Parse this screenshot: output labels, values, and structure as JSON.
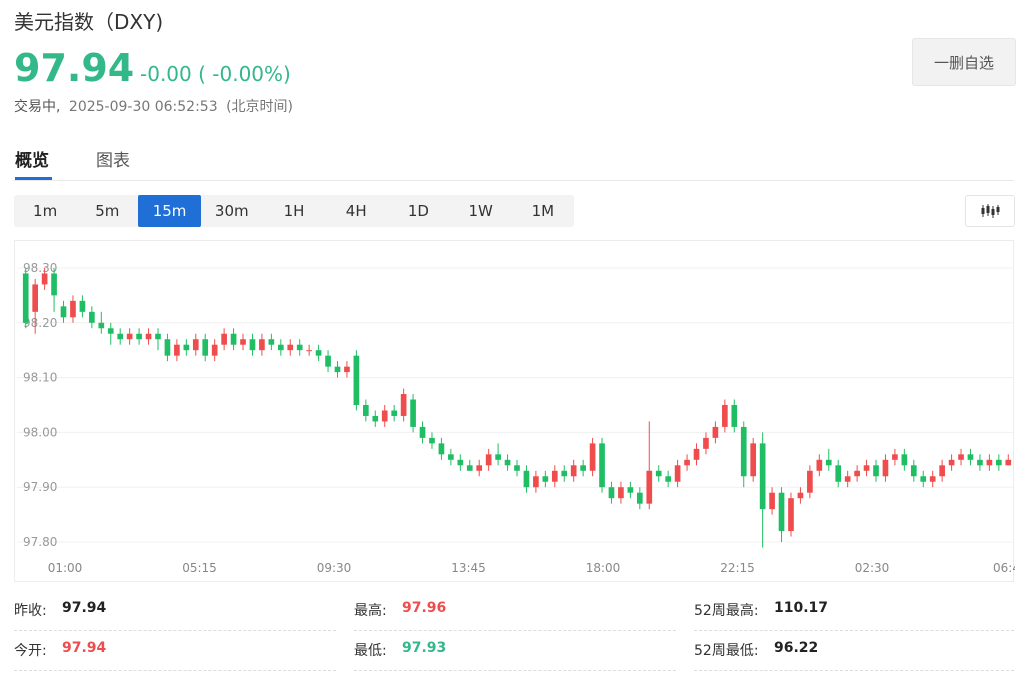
{
  "header": {
    "title": "美元指数（DXY)",
    "price": "97.94",
    "change": "-0.00 ( -0.00%)",
    "status": "交易中,",
    "datetime": "2025-09-30 06:52:53",
    "timezone": "(北京时间)",
    "remove_watchlist_label": "一删自选"
  },
  "tabs": [
    {
      "label": "概览",
      "active": true
    },
    {
      "label": "图表",
      "active": false
    }
  ],
  "periods": [
    {
      "label": "1m"
    },
    {
      "label": "5m"
    },
    {
      "label": "15m",
      "active": true
    },
    {
      "label": "30m"
    },
    {
      "label": "1H"
    },
    {
      "label": "4H"
    },
    {
      "label": "1D"
    },
    {
      "label": "1W"
    },
    {
      "label": "1M"
    }
  ],
  "chart_type_icon": "candlestick-icon",
  "stats": {
    "prev_close_label": "昨收:",
    "prev_close": "97.94",
    "high_label": "最高:",
    "high": "97.96",
    "week52_high_label": "52周最高:",
    "week52_high": "110.17",
    "open_label": "今开:",
    "open": "97.94",
    "low_label": "最低:",
    "low": "97.93",
    "week52_low_label": "52周最低:",
    "week52_low": "96.22"
  },
  "colors": {
    "up": "#ef4d4d",
    "down": "#1fbe64",
    "accent": "#1f6fd6",
    "price": "#33b88a"
  },
  "chart_data": {
    "type": "candlestick",
    "interval": "15m",
    "ylim": [
      97.78,
      98.32
    ],
    "yticks": [
      "98.30",
      "98.20",
      "98.10",
      "98.00",
      "97.90",
      "97.80"
    ],
    "xticks": [
      "01:00",
      "05:15",
      "09:30",
      "13:45",
      "18:00",
      "22:15",
      "02:30",
      "06:4"
    ],
    "grid": true,
    "candles": [
      [
        98.29,
        98.2,
        98.3,
        98.19
      ],
      [
        98.22,
        98.27,
        98.28,
        98.18
      ],
      [
        98.27,
        98.29,
        98.3,
        98.26
      ],
      [
        98.29,
        98.25,
        98.3,
        98.22
      ],
      [
        98.23,
        98.21,
        98.24,
        98.2
      ],
      [
        98.21,
        98.24,
        98.25,
        98.2
      ],
      [
        98.24,
        98.22,
        98.25,
        98.21
      ],
      [
        98.22,
        98.2,
        98.23,
        98.19
      ],
      [
        98.2,
        98.19,
        98.22,
        98.18
      ],
      [
        98.19,
        98.18,
        98.2,
        98.16
      ],
      [
        98.18,
        98.17,
        98.19,
        98.16
      ],
      [
        98.17,
        98.18,
        98.19,
        98.16
      ],
      [
        98.18,
        98.17,
        98.19,
        98.16
      ],
      [
        98.17,
        98.18,
        98.19,
        98.16
      ],
      [
        98.18,
        98.17,
        98.19,
        98.15
      ],
      [
        98.17,
        98.14,
        98.18,
        98.13
      ],
      [
        98.14,
        98.16,
        98.17,
        98.13
      ],
      [
        98.16,
        98.15,
        98.17,
        98.14
      ],
      [
        98.15,
        98.17,
        98.18,
        98.14
      ],
      [
        98.17,
        98.14,
        98.18,
        98.13
      ],
      [
        98.14,
        98.16,
        98.17,
        98.13
      ],
      [
        98.16,
        98.18,
        98.19,
        98.15
      ],
      [
        98.18,
        98.16,
        98.19,
        98.15
      ],
      [
        98.16,
        98.17,
        98.18,
        98.15
      ],
      [
        98.17,
        98.15,
        98.18,
        98.14
      ],
      [
        98.15,
        98.17,
        98.18,
        98.14
      ],
      [
        98.17,
        98.16,
        98.18,
        98.15
      ],
      [
        98.16,
        98.15,
        98.17,
        98.14
      ],
      [
        98.15,
        98.16,
        98.17,
        98.14
      ],
      [
        98.16,
        98.15,
        98.17,
        98.14
      ],
      [
        98.15,
        98.15,
        98.16,
        98.14
      ],
      [
        98.15,
        98.14,
        98.16,
        98.13
      ],
      [
        98.14,
        98.12,
        98.15,
        98.11
      ],
      [
        98.12,
        98.11,
        98.13,
        98.1
      ],
      [
        98.11,
        98.12,
        98.13,
        98.1
      ],
      [
        98.14,
        98.05,
        98.15,
        98.04
      ],
      [
        98.05,
        98.03,
        98.06,
        98.02
      ],
      [
        98.03,
        98.02,
        98.04,
        98.01
      ],
      [
        98.02,
        98.04,
        98.05,
        98.01
      ],
      [
        98.04,
        98.03,
        98.05,
        98.02
      ],
      [
        98.03,
        98.07,
        98.08,
        98.02
      ],
      [
        98.06,
        98.01,
        98.07,
        98.0
      ],
      [
        98.01,
        97.99,
        98.02,
        97.98
      ],
      [
        97.99,
        97.98,
        98.0,
        97.97
      ],
      [
        97.98,
        97.96,
        97.99,
        97.95
      ],
      [
        97.96,
        97.95,
        97.97,
        97.94
      ],
      [
        97.95,
        97.94,
        97.96,
        97.93
      ],
      [
        97.94,
        97.93,
        97.95,
        97.93
      ],
      [
        97.93,
        97.94,
        97.95,
        97.92
      ],
      [
        97.94,
        97.96,
        97.97,
        97.93
      ],
      [
        97.96,
        97.95,
        97.98,
        97.94
      ],
      [
        97.95,
        97.94,
        97.96,
        97.93
      ],
      [
        97.94,
        97.93,
        97.95,
        97.92
      ],
      [
        97.93,
        97.9,
        97.94,
        97.89
      ],
      [
        97.9,
        97.92,
        97.93,
        97.89
      ],
      [
        97.92,
        97.91,
        97.93,
        97.9
      ],
      [
        97.91,
        97.93,
        97.94,
        97.9
      ],
      [
        97.93,
        97.92,
        97.94,
        97.91
      ],
      [
        97.92,
        97.94,
        97.95,
        97.91
      ],
      [
        97.94,
        97.93,
        97.95,
        97.92
      ],
      [
        97.93,
        97.98,
        97.99,
        97.92
      ],
      [
        97.98,
        97.9,
        97.99,
        97.89
      ],
      [
        97.9,
        97.88,
        97.91,
        97.87
      ],
      [
        97.88,
        97.9,
        97.91,
        97.87
      ],
      [
        97.9,
        97.89,
        97.91,
        97.88
      ],
      [
        97.89,
        97.87,
        97.9,
        97.86
      ],
      [
        97.87,
        97.93,
        98.02,
        97.86
      ],
      [
        97.93,
        97.92,
        97.94,
        97.91
      ],
      [
        97.92,
        97.91,
        97.93,
        97.9
      ],
      [
        97.91,
        97.94,
        97.95,
        97.9
      ],
      [
        97.94,
        97.95,
        97.96,
        97.93
      ],
      [
        97.95,
        97.97,
        97.98,
        97.94
      ],
      [
        97.97,
        97.99,
        98.0,
        97.96
      ],
      [
        97.99,
        98.01,
        98.02,
        97.98
      ],
      [
        98.01,
        98.05,
        98.06,
        98.0
      ],
      [
        98.05,
        98.01,
        98.06,
        98.0
      ],
      [
        98.01,
        97.92,
        98.02,
        97.9
      ],
      [
        97.92,
        97.98,
        97.99,
        97.91
      ],
      [
        97.98,
        97.86,
        98.0,
        97.79
      ],
      [
        97.86,
        97.89,
        97.9,
        97.85
      ],
      [
        97.89,
        97.82,
        97.9,
        97.8
      ],
      [
        97.82,
        97.88,
        97.89,
        97.81
      ],
      [
        97.88,
        97.89,
        97.9,
        97.87
      ],
      [
        97.89,
        97.93,
        97.94,
        97.88
      ],
      [
        97.93,
        97.95,
        97.96,
        97.92
      ],
      [
        97.95,
        97.94,
        97.97,
        97.93
      ],
      [
        97.94,
        97.91,
        97.95,
        97.9
      ],
      [
        97.91,
        97.92,
        97.93,
        97.9
      ],
      [
        97.92,
        97.93,
        97.94,
        97.91
      ],
      [
        97.93,
        97.94,
        97.95,
        97.92
      ],
      [
        97.94,
        97.92,
        97.95,
        97.91
      ],
      [
        97.92,
        97.95,
        97.96,
        97.91
      ],
      [
        97.95,
        97.96,
        97.97,
        97.94
      ],
      [
        97.96,
        97.94,
        97.97,
        97.93
      ],
      [
        97.94,
        97.92,
        97.95,
        97.91
      ],
      [
        97.92,
        97.91,
        97.93,
        97.9
      ],
      [
        97.91,
        97.92,
        97.93,
        97.9
      ],
      [
        97.92,
        97.94,
        97.95,
        97.91
      ],
      [
        97.94,
        97.95,
        97.96,
        97.93
      ],
      [
        97.95,
        97.96,
        97.97,
        97.94
      ],
      [
        97.96,
        97.95,
        97.97,
        97.94
      ],
      [
        97.95,
        97.94,
        97.96,
        97.93
      ],
      [
        97.94,
        97.95,
        97.96,
        97.93
      ],
      [
        97.95,
        97.94,
        97.96,
        97.93
      ],
      [
        97.94,
        97.95,
        97.96,
        97.94
      ]
    ]
  }
}
